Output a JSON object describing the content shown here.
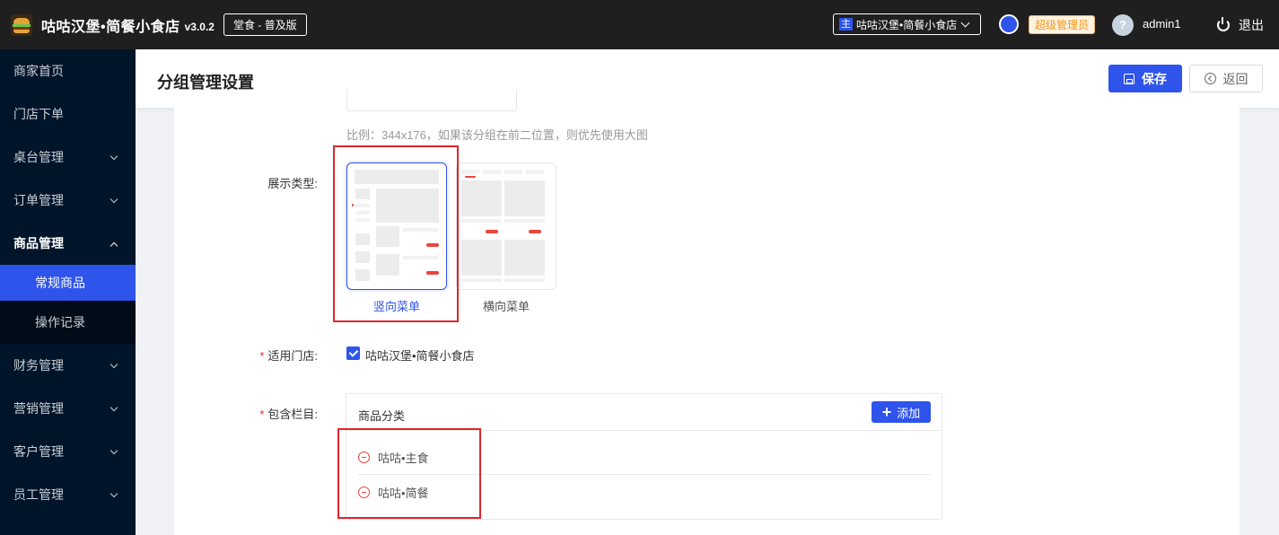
{
  "topbar": {
    "app_title": "咕咕汉堡•简餐小食店",
    "version": "v3.0.2",
    "edition": "堂食 - 普及版",
    "store_badge": "主",
    "store_name": "咕咕汉堡•简餐小食店",
    "role": "超级管理员",
    "avatar_glyph": "?",
    "username": "admin1",
    "logout": "退出"
  },
  "sidebar": {
    "items": [
      {
        "label": "商家首页"
      },
      {
        "label": "门店下单"
      },
      {
        "label": "桌台管理"
      },
      {
        "label": "订单管理"
      },
      {
        "label": "商品管理"
      },
      {
        "label": "财务管理"
      },
      {
        "label": "营销管理"
      },
      {
        "label": "客户管理"
      },
      {
        "label": "员工管理"
      }
    ],
    "sub_items": [
      {
        "label": "常规商品"
      },
      {
        "label": "操作记录"
      }
    ]
  },
  "header": {
    "title": "分组管理设置",
    "save_label": "保存",
    "back_label": "返回"
  },
  "form": {
    "image_hint": "比例：344x176，如果该分组在前二位置，则优先使用大图",
    "display_type_label": "展示类型:",
    "display_types": [
      {
        "label": "竖向菜单",
        "selected": true
      },
      {
        "label": "横向菜单",
        "selected": false
      }
    ],
    "store_label": "适用门店:",
    "store_option": "咕咕汉堡•简餐小食店",
    "columns_label": "包含栏目:",
    "category_title": "商品分类",
    "add_label": "添加",
    "categories": [
      {
        "name": "咕咕•主食"
      },
      {
        "name": "咕咕•简餐"
      }
    ]
  },
  "colors": {
    "primary": "#2f54eb",
    "sidebar_bg": "#001529",
    "topbar_bg": "#1f1f1f",
    "highlight_box": "#e0262b"
  }
}
